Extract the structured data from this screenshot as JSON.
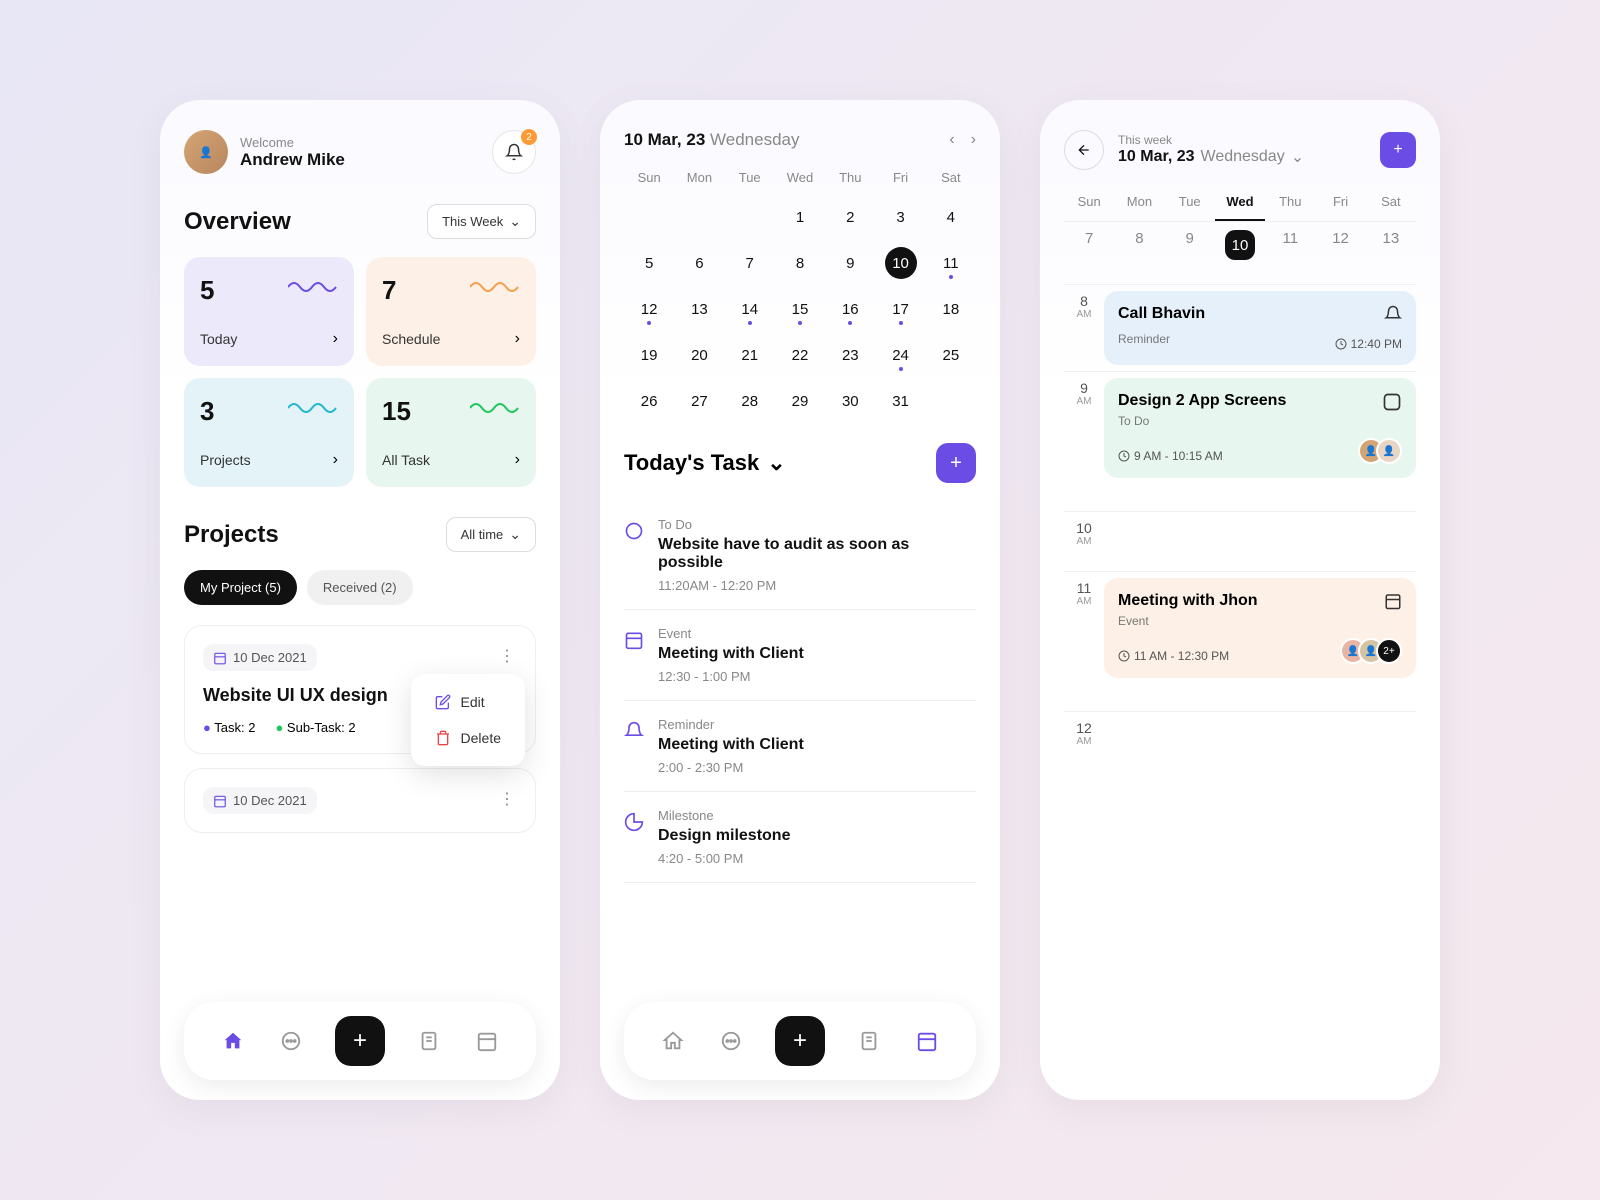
{
  "phone1": {
    "welcome": "Welcome",
    "username": "Andrew Mike",
    "bell_badge": "2",
    "overview_title": "Overview",
    "overview_filter": "This Week",
    "stats": [
      {
        "num": "5",
        "label": "Today"
      },
      {
        "num": "7",
        "label": "Schedule"
      },
      {
        "num": "3",
        "label": "Projects"
      },
      {
        "num": "15",
        "label": "All Task"
      }
    ],
    "projects_title": "Projects",
    "projects_filter": "All time",
    "tabs": {
      "active": "My Project (5)",
      "inactive": "Received (2)"
    },
    "project1": {
      "date": "10 Dec 2021",
      "title": "Website UI UX design",
      "task_count": "Task: 2",
      "subtask_count": "Sub-Task: 2"
    },
    "project2": {
      "date": "10 Dec 2021"
    },
    "menu": {
      "edit": "Edit",
      "delete": "Delete"
    }
  },
  "phone2": {
    "date": "10 Mar, 23",
    "day": "Wednesday",
    "weekdays": [
      "Sun",
      "Mon",
      "Tue",
      "Wed",
      "Thu",
      "Fri",
      "Sat"
    ],
    "days": [
      "1",
      "2",
      "3",
      "4",
      "5",
      "6",
      "7",
      "8",
      "9",
      "10",
      "11",
      "12",
      "13",
      "14",
      "15",
      "16",
      "17",
      "18",
      "19",
      "20",
      "21",
      "22",
      "23",
      "24",
      "25",
      "26",
      "27",
      "28",
      "29",
      "30",
      "31"
    ],
    "tasks_title": "Today's Task",
    "tasks": [
      {
        "cat": "To Do",
        "title": "Website have to audit as soon as possible",
        "time": "11:20AM - 12:20 PM"
      },
      {
        "cat": "Event",
        "title": "Meeting with Client",
        "time": "12:30 - 1:00 PM"
      },
      {
        "cat": "Reminder",
        "title": "Meeting with Client",
        "time": "2:00 - 2:30 PM"
      },
      {
        "cat": "Milestone",
        "title": "Design milestone",
        "time": "4:20 - 5:00 PM"
      }
    ]
  },
  "phone3": {
    "subtitle": "This week",
    "date": "10 Mar, 23",
    "day": "Wednesday",
    "weekdays": [
      "Sun",
      "Mon",
      "Tue",
      "Wed",
      "Thu",
      "Fri",
      "Sat"
    ],
    "dates": [
      "7",
      "8",
      "9",
      "10",
      "11",
      "12",
      "13"
    ],
    "hours": [
      "8",
      "9",
      "10",
      "11",
      "12"
    ],
    "ampm": "AM",
    "events": {
      "e1": {
        "title": "Call Bhavin",
        "cat": "Reminder",
        "time": "12:40 PM"
      },
      "e2": {
        "title": "Design 2 App Screens",
        "cat": "To Do",
        "time": "9 AM - 10:15 AM"
      },
      "e3": {
        "title": "Meeting with Jhon",
        "cat": "Event",
        "time": "11 AM - 12:30 PM",
        "extra": "2+"
      }
    }
  }
}
